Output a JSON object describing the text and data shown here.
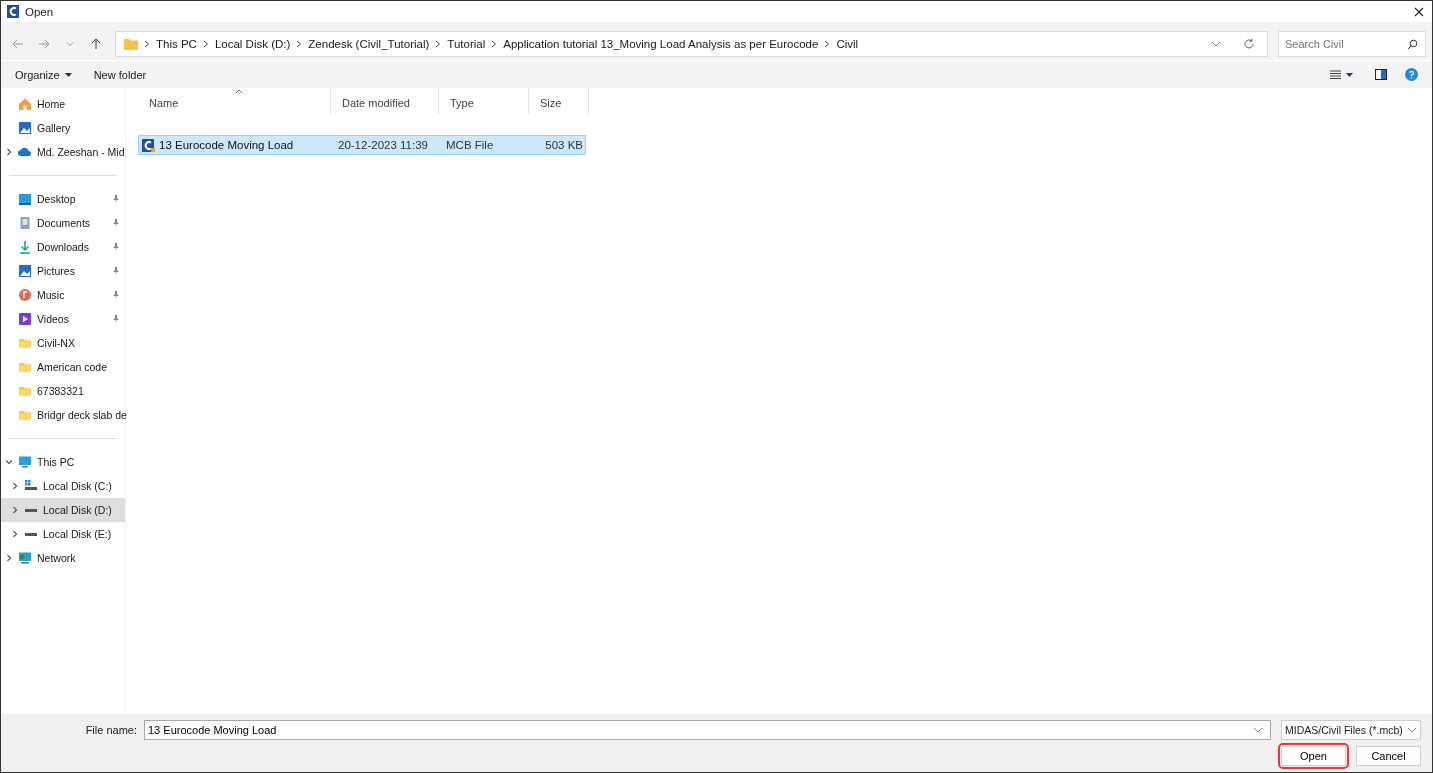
{
  "window": {
    "title": "Open"
  },
  "address": {
    "crumbs": [
      "This PC",
      "Local Disk (D:)",
      "Zendesk (Civil_Tutorial)",
      "Tutorial",
      "Application tutorial 13_Moving Load Analysis as per Eurocode",
      "Civil"
    ]
  },
  "search": {
    "placeholder": "Search Civil"
  },
  "toolbar": {
    "organize": "Organize",
    "new_folder": "New folder"
  },
  "sidebar": {
    "groups": [
      {
        "items": [
          {
            "kind": "home",
            "label": "Home",
            "pinned": false,
            "expandable": false,
            "expanded": false,
            "selected": false
          },
          {
            "kind": "gallery",
            "label": "Gallery",
            "pinned": false,
            "expandable": false,
            "expanded": false,
            "selected": false
          },
          {
            "kind": "cloud",
            "label": "Md. Zeeshan - Mid",
            "pinned": false,
            "expandable": true,
            "expanded": false,
            "selected": false
          }
        ]
      },
      {
        "items": [
          {
            "kind": "desktop",
            "label": "Desktop",
            "pinned": true,
            "expandable": false,
            "expanded": false,
            "selected": false
          },
          {
            "kind": "documents",
            "label": "Documents",
            "pinned": true,
            "expandable": false,
            "expanded": false,
            "selected": false
          },
          {
            "kind": "downloads",
            "label": "Downloads",
            "pinned": true,
            "expandable": false,
            "expanded": false,
            "selected": false
          },
          {
            "kind": "pictures",
            "label": "Pictures",
            "pinned": true,
            "expandable": false,
            "expanded": false,
            "selected": false
          },
          {
            "kind": "music",
            "label": "Music",
            "pinned": true,
            "expandable": false,
            "expanded": false,
            "selected": false
          },
          {
            "kind": "videos",
            "label": "Videos",
            "pinned": true,
            "expandable": false,
            "expanded": false,
            "selected": false
          },
          {
            "kind": "folder",
            "label": "Civil-NX",
            "pinned": false,
            "expandable": false,
            "expanded": false,
            "selected": false
          },
          {
            "kind": "folder",
            "label": "American code",
            "pinned": false,
            "expandable": false,
            "expanded": false,
            "selected": false
          },
          {
            "kind": "folder",
            "label": "67383321",
            "pinned": false,
            "expandable": false,
            "expanded": false,
            "selected": false
          },
          {
            "kind": "folder",
            "label": "Bridgr deck slab de",
            "pinned": false,
            "expandable": false,
            "expanded": false,
            "selected": false
          }
        ]
      },
      {
        "items": [
          {
            "kind": "pc",
            "label": "This PC",
            "pinned": false,
            "expandable": true,
            "expanded": true,
            "selected": false,
            "children": [
              {
                "kind": "windrive",
                "label": "Local Disk (C:)",
                "pinned": false,
                "expandable": true,
                "expanded": false,
                "selected": false
              },
              {
                "kind": "drive",
                "label": "Local Disk (D:)",
                "pinned": false,
                "expandable": true,
                "expanded": false,
                "selected": true
              },
              {
                "kind": "drive",
                "label": "Local Disk (E:)",
                "pinned": false,
                "expandable": true,
                "expanded": false,
                "selected": false
              }
            ]
          },
          {
            "kind": "network",
            "label": "Network",
            "pinned": false,
            "expandable": true,
            "expanded": false,
            "selected": false
          }
        ]
      }
    ]
  },
  "table": {
    "columns": [
      {
        "label": "Name",
        "sorted": true
      },
      {
        "label": "Date modified",
        "sorted": false
      },
      {
        "label": "Type",
        "sorted": false
      },
      {
        "label": "Size",
        "sorted": false
      }
    ],
    "rows": [
      {
        "name": "13 Eurocode Moving Load",
        "date": "20-12-2023 11:39",
        "type": "MCB File",
        "size": "503 KB",
        "selected": true
      }
    ]
  },
  "footer": {
    "file_name_label": "File name:",
    "file_name": "13 Eurocode Moving Load",
    "file_type": "MIDAS/Civil Files (*.mcb)",
    "buttons": [
      {
        "label": "Open",
        "highlighted": true
      },
      {
        "label": "Cancel",
        "highlighted": false
      }
    ]
  }
}
